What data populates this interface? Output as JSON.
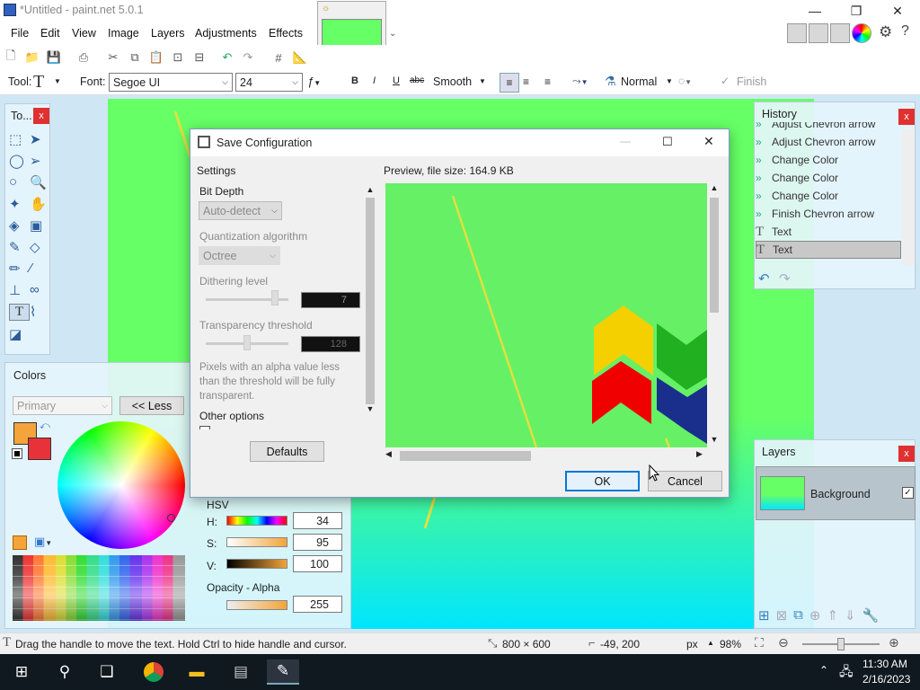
{
  "window": {
    "title": "*Untitled - paint.net 5.0.1"
  },
  "menu": [
    "File",
    "Edit",
    "View",
    "Image",
    "Layers",
    "Adjustments",
    "Effects"
  ],
  "toolbar": {
    "tool_label": "Tool:",
    "font_label": "Font:",
    "font_value": "Segoe UI",
    "size_value": "24",
    "antialias": "Smooth",
    "blend": "Normal",
    "finish": "Finish"
  },
  "tools_panel": {
    "title": "To..."
  },
  "history": {
    "title": "History",
    "items": [
      "Adjust Chevron arrow",
      "Adjust Chevron arrow",
      "Change Color",
      "Change Color",
      "Change Color",
      "Finish Chevron arrow",
      "Text",
      "Text"
    ]
  },
  "layers": {
    "title": "Layers",
    "items": [
      "Background"
    ]
  },
  "colors": {
    "title": "Colors",
    "mode": "Primary",
    "less_button": "<< Less",
    "hsv_label": "HSV",
    "h_label": "H:",
    "h_value": "34",
    "s_label": "S:",
    "s_value": "95",
    "v_label": "V:",
    "v_value": "100",
    "opacity_label": "Opacity - Alpha",
    "opacity_value": "255",
    "primary_color": "#f4a43a",
    "secondary_color": "#e8323a"
  },
  "dialog": {
    "title": "Save Configuration",
    "settings_label": "Settings",
    "preview_label": "Preview, file size: 164.9 KB",
    "bit_depth_label": "Bit Depth",
    "bit_depth_value": "Auto-detect",
    "quant_label": "Quantization algorithm",
    "quant_value": "Octree",
    "dither_label": "Dithering level",
    "dither_value": "7",
    "transp_label": "Transparency threshold",
    "transp_value": "128",
    "transp_note": "Pixels with an alpha value less than the threshold will be fully transparent.",
    "other_label": "Other options",
    "defaults_button": "Defaults",
    "ok_button": "OK",
    "cancel_button": "Cancel"
  },
  "status": {
    "hint": "Drag the handle to move the text. Hold Ctrl to hide handle and cursor.",
    "size": "800 × 600",
    "coords": "-49, 200",
    "unit": "px",
    "zoom": "98%"
  },
  "taskbar": {
    "time": "11:30 AM",
    "date": "2/16/2023"
  }
}
